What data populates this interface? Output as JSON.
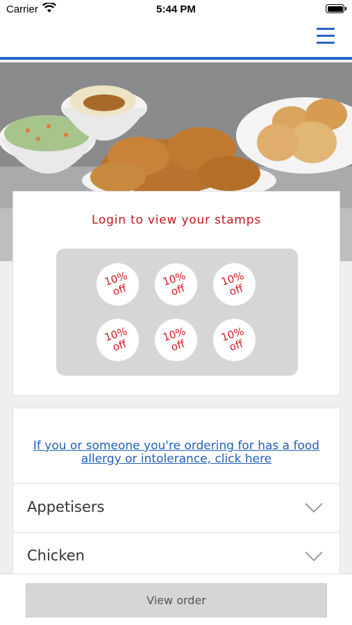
{
  "status_bar": {
    "carrier": "Carrier",
    "time": "5:44 PM"
  },
  "navbar": {
    "menu_icon": "hamburger-icon",
    "accent": "#2563c7"
  },
  "hero": {
    "image": "fried-chicken-meal-photo"
  },
  "stamps": {
    "title": "Login to view your stamps",
    "stamp_label": "10%\noff",
    "count": 6,
    "title_color": "#c4161c"
  },
  "allergy_link": "If you or someone you're ordering for has a food allergy or intolerance, click here",
  "menu_sections": [
    {
      "label": "Appetisers"
    },
    {
      "label": "Chicken"
    }
  ],
  "bottom": {
    "view_order_label": "View order"
  }
}
